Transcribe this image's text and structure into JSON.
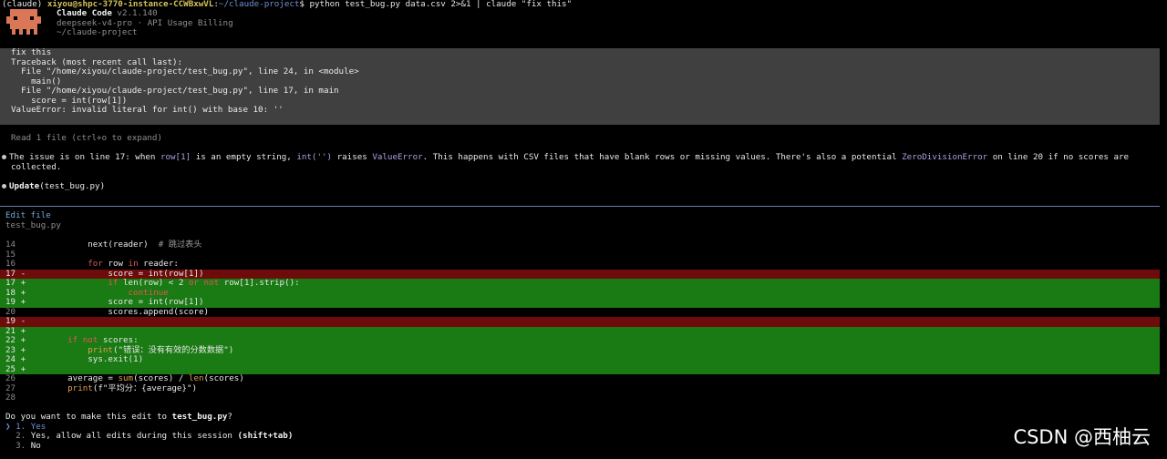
{
  "shell": {
    "env": "(claude)",
    "user_host": "xiyou@shpc-3770-instance-CCWBxwVL",
    "path": "~/claude-project",
    "command": "$ python test_bug.py data.csv 2>&1 | claude \"fix this\""
  },
  "header": {
    "app_name": "Claude Code",
    "version": "v2.1.140",
    "model": "deepseek-v4-pro · API Usage Billing",
    "cwd": "~/claude-project"
  },
  "prompt": {
    "lines": [
      "fix this",
      "Traceback (most recent call last):",
      "  File \"/home/xiyou/claude-project/test_bug.py\", line 24, in <module>",
      "    main()",
      "  File \"/home/xiyou/claude-project/test_bug.py\", line 17, in main",
      "    score = int(row[1])",
      "ValueError: invalid literal for int() with base 10: ''"
    ]
  },
  "read_status": "Read 1 file (ctrl+o to expand)",
  "explanation": {
    "p1": "The issue is on line 17: when ",
    "c1": "row[1]",
    "p2": " is an empty string, ",
    "c2": "int('')",
    "p3": " raises ",
    "c3": "ValueError",
    "p4": ". This happens with CSV files that have blank rows or missing values. There's also a potential ",
    "c4": "ZeroDivisionError",
    "p5": " on line 20 if no scores are",
    "line2": "collected."
  },
  "update": {
    "label": "Update",
    "arg": "(test_bug.py)"
  },
  "edit": {
    "title": "Edit file",
    "filename": "test_bug.py"
  },
  "diff": {
    "l14": {
      "no": "14",
      "a": "        next(reader)  ",
      "b": "# 跳过表头"
    },
    "l15": {
      "no": "15"
    },
    "l16": {
      "no": "16",
      "a": "        ",
      "k": "for",
      "b": " row ",
      "k2": "in",
      "c": " reader:"
    },
    "l17d": {
      "no": "17 -",
      "a": "            score = int(row[1])"
    },
    "l17a": {
      "no": "17 +",
      "a": "            ",
      "k": "if",
      "b": " len(row) < 2 ",
      "k2": "or",
      "c": " ",
      "k3": "not",
      "d": " row[1].strip():"
    },
    "l18a": {
      "no": "18 +",
      "a": "                ",
      "k": "continue"
    },
    "l19a": {
      "no": "19 +",
      "a": "            score = int(row[1])"
    },
    "l20": {
      "no": "20",
      "a": "            scores.append(score)"
    },
    "l19d": {
      "no": "19 -"
    },
    "l21a": {
      "no": "21 +"
    },
    "l22a": {
      "no": "22 +",
      "a": "    ",
      "k": "if",
      "b": " ",
      "k2": "not",
      "c": " scores:"
    },
    "l23a": {
      "no": "23 +",
      "a": "        ",
      "f": "print",
      "b": "(\"错误：没有有效的分数数据\")"
    },
    "l24a": {
      "no": "24 +",
      "a": "        sys.exit(1)"
    },
    "l25a": {
      "no": "25 +"
    },
    "l26": {
      "no": "26",
      "a": "    average = ",
      "f": "sum",
      "b": "(scores) / ",
      "f2": "len",
      "c": "(scores)"
    },
    "l27": {
      "no": "27",
      "a": "    ",
      "f": "print",
      "b": "(f\"平均分：{average}\")"
    },
    "l28": {
      "no": "28"
    }
  },
  "question": {
    "p1": "Do you want to make this edit to ",
    "file": "test_bug.py",
    "p2": "?"
  },
  "options": {
    "o1": {
      "marker": "❯",
      "num": "1.",
      "label": "Yes"
    },
    "o2": {
      "num": "2.",
      "label": "Yes, allow all edits during this session ",
      "hint": "(shift+tab)"
    },
    "o3": {
      "num": "3.",
      "label": "No"
    }
  },
  "watermark": "CSDN @西柚云",
  "colors": {
    "logo": "#d97757",
    "added_bg": "#1a7a14",
    "removed_bg": "#6e0b0b",
    "prompt_bg": "#404040"
  }
}
